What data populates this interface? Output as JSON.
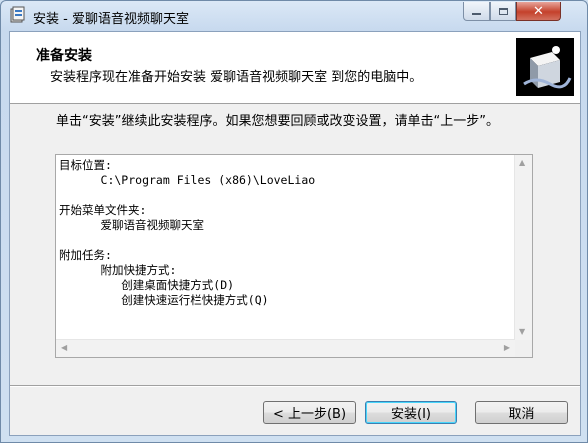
{
  "window": {
    "title": "安装 - 爱聊语音视频聊天室",
    "close_glyph": "✕"
  },
  "header": {
    "title": "准备安装",
    "subtitle": "安装程序现在准备开始安装 爱聊语音视频聊天室 到您的电脑中。"
  },
  "body": {
    "instruction": "单击“安装”继续此安装程序。如果您想要回顾或改变设置，请单击“上一步”。"
  },
  "memo": {
    "lines": [
      "目标位置:",
      "      C:\\Program Files (x86)\\LoveLiao",
      "",
      "开始菜单文件夹:",
      "      爱聊语音视频聊天室",
      "",
      "附加任务:",
      "      附加快捷方式:",
      "         创建桌面快捷方式(D)",
      "         创建快速运行栏快捷方式(Q)"
    ]
  },
  "buttons": {
    "back": "< 上一步(B)",
    "install": "安装(I)",
    "cancel": "取消"
  },
  "colors": {
    "accent": "#3c7fb1",
    "close": "#c4412b"
  }
}
